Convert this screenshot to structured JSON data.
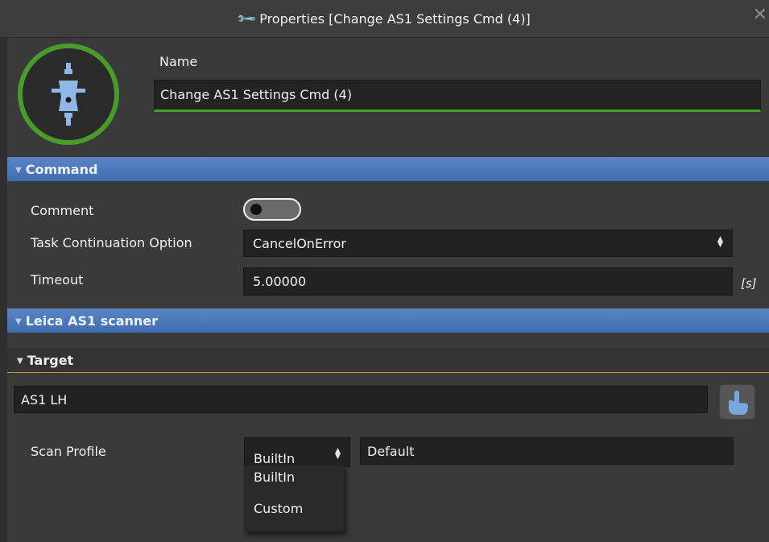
{
  "window": {
    "title": "Properties [Change AS1 Settings Cmd (4)]",
    "title_icon": "wrench-icon",
    "close_icon": "close-icon"
  },
  "header": {
    "icon": "conveyor-command-icon",
    "name_label": "Name",
    "name_value": "Change AS1 Settings Cmd (4)",
    "accent_color": "#4a9a2c"
  },
  "sections": {
    "command": "Command",
    "leica": "Leica AS1 scanner",
    "target": "Target"
  },
  "command": {
    "comment_label": "Comment",
    "comment_enabled": false,
    "task_label": "Task Continuation Option",
    "task_value": "CancelOnError",
    "timeout_label": "Timeout",
    "timeout_value": "5.00000",
    "timeout_unit": "[s]"
  },
  "target": {
    "value": "AS1 LH",
    "pick_icon": "hand-pointer-icon",
    "scan_profile_label": "Scan Profile",
    "scan_profile_type": "BuiltIn",
    "scan_profile_value": "Default",
    "dropdown_options": [
      "BuiltIn",
      "Custom"
    ]
  },
  "colors": {
    "section_blue": "#4a78bb",
    "target_underline": "#c29a3a"
  }
}
